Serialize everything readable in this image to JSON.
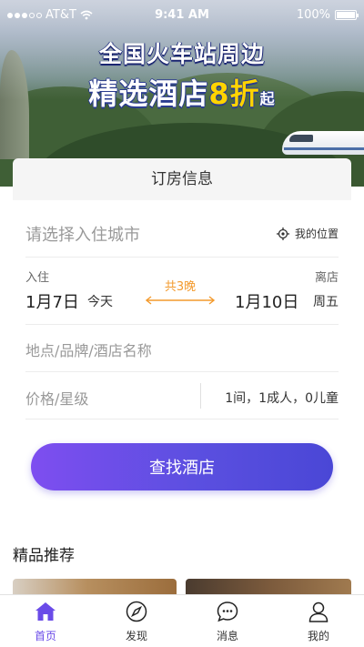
{
  "status_bar": {
    "carrier": "AT&T",
    "time": "9:41 AM",
    "battery": "100%"
  },
  "banner": {
    "line1": "全国火车站周边",
    "line2_main": "精选酒店",
    "line2_highlight": "8折",
    "line2_suffix": "起"
  },
  "booking": {
    "title": "订房信息",
    "city_placeholder": "请选择入住城市",
    "my_location": "我的位置",
    "checkin_label": "入住",
    "checkout_label": "离店",
    "checkin_date": "1月7日",
    "checkin_day": "今天",
    "checkout_date": "1月10日",
    "checkout_day": "周五",
    "nights": "共3晚",
    "keyword_placeholder": "地点/品牌/酒店名称",
    "price_placeholder": "价格/星级",
    "guests": "1间，1成人，0儿童",
    "search_button": "查找酒店"
  },
  "recommend": {
    "title": "精品推荐"
  },
  "tabs": [
    {
      "label": "首页",
      "icon": "home-icon",
      "active": true
    },
    {
      "label": "发现",
      "icon": "compass-icon",
      "active": false
    },
    {
      "label": "消息",
      "icon": "message-icon",
      "active": false
    },
    {
      "label": "我的",
      "icon": "user-icon",
      "active": false
    }
  ],
  "colors": {
    "accent": "#6a4be8",
    "nights": "#f39a2d",
    "button_start": "#7e4ef0",
    "button_end": "#4a47d6"
  }
}
